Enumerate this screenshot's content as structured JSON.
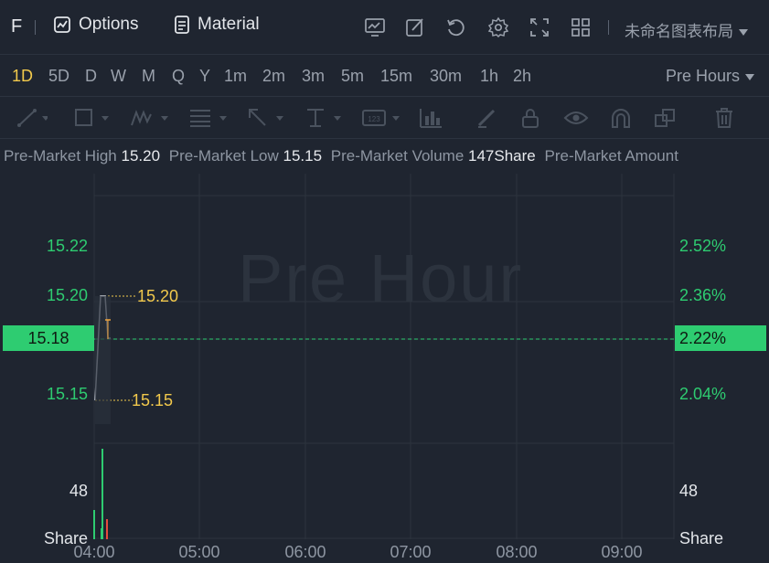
{
  "header": {
    "ticker": "F",
    "options_label": "Options",
    "material_label": "Material",
    "layout_name": "未命名图表布局",
    "icons": [
      "chart-line-icon",
      "edit-icon",
      "refresh-icon",
      "gear-icon",
      "fullscreen-icon",
      "grid-icon"
    ]
  },
  "periods": {
    "items": [
      "1D",
      "5D",
      "D",
      "W",
      "M",
      "Q",
      "Y",
      "1m",
      "2m",
      "3m",
      "5m",
      "15m",
      "30m",
      "1h",
      "2h"
    ],
    "active": "1D",
    "session_label": "Pre Hours"
  },
  "tools": [
    "trendline-icon",
    "rectangle-icon",
    "pattern-icon",
    "fib-icon",
    "arrow-icon",
    "measure-icon",
    "number-icon",
    "bars-icon",
    "pen-icon",
    "lock-icon",
    "eye-icon",
    "magnet-icon",
    "layers-icon",
    "trash-icon"
  ],
  "info": {
    "high_label": "Pre-Market High",
    "high_value": "15.20",
    "low_label": "Pre-Market Low",
    "low_value": "15.15",
    "volume_label": "Pre-Market Volume",
    "volume_value": "147Share",
    "amount_label": "Pre-Market Amount"
  },
  "chart": {
    "watermark": "Pre Hour",
    "y_left": [
      "15.22",
      "15.20",
      "15.15"
    ],
    "y_right": [
      "2.52%",
      "2.36%",
      "2.04%"
    ],
    "current_price": "15.18",
    "current_pct": "2.22%",
    "high_line_label": "15.20",
    "low_line_label": "15.15",
    "volume_tick": "48",
    "volume_unit": "Share",
    "x_labels": [
      "04:00",
      "05:00",
      "06:00",
      "07:00",
      "08:00",
      "09:00"
    ],
    "colors": {
      "up": "#2ecc71",
      "down": "#e74c3c",
      "accent": "#f2c94c"
    }
  }
}
